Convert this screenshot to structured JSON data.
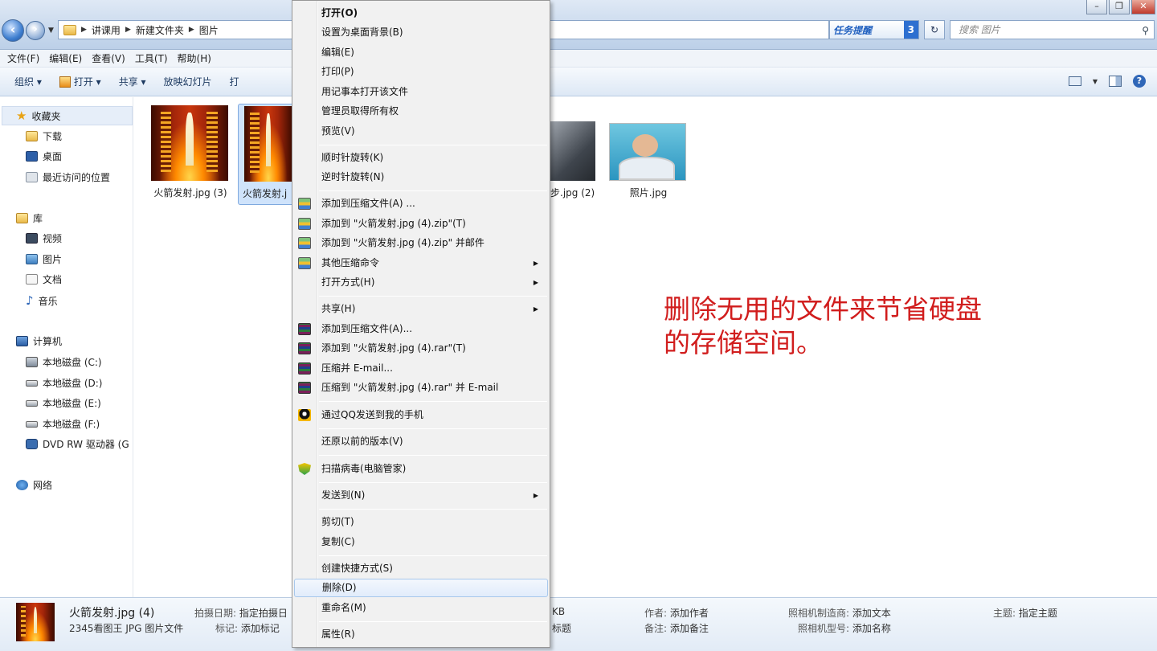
{
  "window": {
    "breadcrumb": [
      "讲课用",
      "新建文件夹",
      "图片"
    ],
    "tasks_label": "任务提醒",
    "tasks_count": "3",
    "search_placeholder": "搜索 图片"
  },
  "menubar": [
    "文件(F)",
    "编辑(E)",
    "查看(V)",
    "工具(T)",
    "帮助(H)"
  ],
  "toolbar": {
    "organize": "组织 ▾",
    "open": "打开 ▾",
    "share": "共享 ▾",
    "slideshow": "放映幻灯片",
    "print": "打"
  },
  "nav": {
    "favorites": "收藏夹",
    "downloads": "下载",
    "desktop": "桌面",
    "recent": "最近访问的位置",
    "libraries": "库",
    "videos": "视频",
    "pictures": "图片",
    "documents": "文档",
    "music": "音乐",
    "computer": "计算机",
    "drive_c": "本地磁盘 (C:)",
    "drive_d": "本地磁盘 (D:)",
    "drive_e": "本地磁盘 (E:)",
    "drive_f": "本地磁盘 (F:)",
    "dvd": "DVD RW 驱动器 (G",
    "network": "网络"
  },
  "files": [
    {
      "name": "火箭发射.jpg (3)"
    },
    {
      "name": "火箭发射.j"
    },
    {
      "name": "步.jpg (2)"
    },
    {
      "name": "照片.jpg"
    }
  ],
  "annotation": {
    "line1": "删除无用的文件来节省硬盘",
    "line2": "的存储空间。"
  },
  "context_menu": [
    {
      "label": "打开(O)"
    },
    {
      "label": "设置为桌面背景(B)"
    },
    {
      "label": "编辑(E)"
    },
    {
      "label": "打印(P)"
    },
    {
      "label": "用记事本打开该文件"
    },
    {
      "label": "管理员取得所有权"
    },
    {
      "label": "预览(V)"
    },
    {
      "label": "顺时针旋转(K)"
    },
    {
      "label": "逆时针旋转(N)"
    },
    {
      "label": "添加到压缩文件(A) ..."
    },
    {
      "label": "添加到 \"火箭发射.jpg (4).zip\"(T)"
    },
    {
      "label": "添加到 \"火箭发射.jpg (4).zip\" 并邮件"
    },
    {
      "label": "其他压缩命令"
    },
    {
      "label": "打开方式(H)"
    },
    {
      "label": "共享(H)"
    },
    {
      "label": "添加到压缩文件(A)..."
    },
    {
      "label": "添加到 \"火箭发射.jpg (4).rar\"(T)"
    },
    {
      "label": "压缩并 E-mail..."
    },
    {
      "label": "压缩到 \"火箭发射.jpg (4).rar\" 并 E-mail"
    },
    {
      "label": "通过QQ发送到我的手机"
    },
    {
      "label": "还原以前的版本(V)"
    },
    {
      "label": "扫描病毒(电脑管家)"
    },
    {
      "label": "发送到(N)"
    },
    {
      "label": "剪切(T)"
    },
    {
      "label": "复制(C)"
    },
    {
      "label": "创建快捷方式(S)"
    },
    {
      "label": "删除(D)"
    },
    {
      "label": "重命名(M)"
    },
    {
      "label": "属性(R)"
    }
  ],
  "details": {
    "filename": "火箭发射.jpg (4)",
    "filetype": "2345看图王 JPG 图片文件",
    "date_label": "拍摄日期:",
    "date_value": "指定拍摄日",
    "tags_label": "标记:",
    "tags_value": "添加标记",
    "size_fragment": "KB",
    "title_fragment": "标题",
    "author_label": "作者:",
    "author_value": "添加作者",
    "comment_label": "备注:",
    "comment_value": "添加备注",
    "maker_label": "照相机制造商:",
    "maker_value": "添加文本",
    "model_label": "照相机型号:",
    "model_value": "添加名称",
    "subject_label": "主题:",
    "subject_value": "指定主题"
  }
}
